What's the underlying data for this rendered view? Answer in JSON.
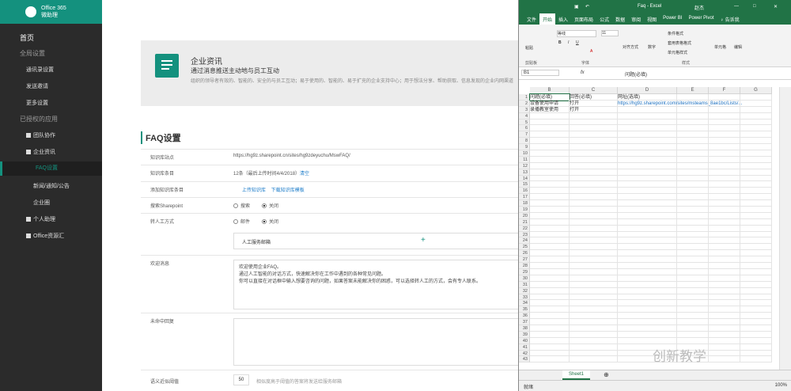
{
  "sidebar": {
    "brand_line1": "Office 365",
    "brand_line2": "微助理",
    "items": [
      {
        "label": "首页"
      },
      {
        "label": "全局设置"
      },
      {
        "label": "通讯录设置"
      },
      {
        "label": "发送邀请"
      },
      {
        "label": "更多设置"
      },
      {
        "label": "已授权的应用"
      },
      {
        "label": "团队协作"
      },
      {
        "label": "企业资讯"
      },
      {
        "label": "FAQ设置"
      },
      {
        "label": "新闻/通知/公告"
      },
      {
        "label": "企业圈"
      },
      {
        "label": "个人助理"
      },
      {
        "label": "Office资源汇"
      }
    ]
  },
  "hero": {
    "title": "企业资讯",
    "subtitle": "通过消息推送主动地与员工互动",
    "desc": "组织的领导者有效的、智能的、安全的与员工互动；易于使用的、智能的、易于扩充的企业支持中心；用于想法分享、帮助获取、信息发现的企业内网渠道"
  },
  "faq": {
    "title": "FAQ设置",
    "site_label": "知识库站点",
    "site_url": "https://hg9z.sharepoint.cn/sites/hg9zdeyuchu/MswFAQ/",
    "count_label": "知识库条目",
    "count_value": "12条（最后上传时间4/4/2018）",
    "count_action": "清空",
    "add_label": "添加知识库条目",
    "upload": "上传知识库",
    "download": "下载知识库模板",
    "search_label": "搜索Sharepoint",
    "search_on": "搜索",
    "search_off": "关闭",
    "transfer_label": "转人工方式",
    "transfer_mail": "邮件",
    "transfer_off": "关闭",
    "mail_label": "人工服务邮箱",
    "welcome_label": "欢迎消息",
    "welcome_text": "欢迎使用企业FAQ。\n通过人工智能的对话方式，快速解决你在工作中遇到的各种常见问题。\n你可以直接在对话框中输入想要咨询的问题，如果答案未能解决你的困惑，可以选择转人工的方式，会有专人联系。",
    "miss_label": "未命中回复",
    "threshold_label": "语义近似阈值",
    "threshold_value": "50",
    "threshold_hint": "相似度高于阈值的答案将发送给服务邮箱"
  },
  "excel": {
    "filename": "Faq - Excel",
    "user": "赵杰",
    "tabs": [
      "文件",
      "开始",
      "插入",
      "页面布局",
      "公式",
      "数据",
      "审阅",
      "视图",
      "Power BI",
      "Power Pivot",
      "♀ 告诉我"
    ],
    "ribbon": {
      "paste": "粘贴",
      "clipboard": "剪贴板",
      "font_name": "等线",
      "font_size": "11",
      "font": "字体",
      "align": "对齐方式",
      "number": "数字",
      "cond": "条件格式",
      "table": "套用表格格式",
      "cellstyle": "单元格样式",
      "styles": "样式",
      "cells": "单元格",
      "edit": "编辑"
    },
    "namebox": "B1",
    "formula": "问题(必填)",
    "columns": [
      "B",
      "C",
      "D",
      "E",
      "F",
      "G"
    ],
    "rows": [
      [
        "问题(必填)",
        "回答(必填)",
        "网址(选填)"
      ],
      [
        "设备使用申请",
        "打开",
        "https://hg9z.sharepoint.com/sites/msteams_8ae1bc/Lists/..."
      ],
      [
        "录播教室使用",
        "打开",
        ""
      ]
    ],
    "row_count": 43,
    "sheet": "Sheet1",
    "status": "就绪",
    "zoom": "100%"
  },
  "watermark": "创新教学"
}
